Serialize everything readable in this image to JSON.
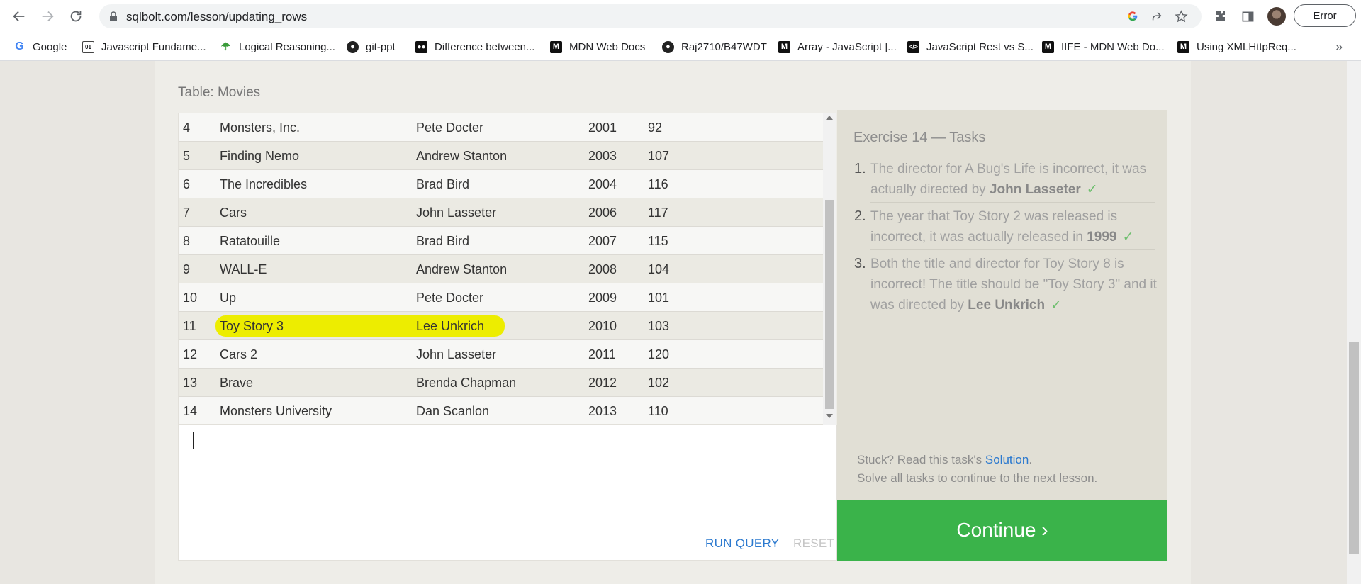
{
  "browser": {
    "url": "sqlbolt.com/lesson/updating_rows",
    "error_label": "Error",
    "bookmarks": [
      {
        "label": "Google",
        "icon": "google-icon"
      },
      {
        "label": "Javascript Fundame...",
        "icon": "code-book-icon"
      },
      {
        "label": "Logical Reasoning...",
        "icon": "umbrella-icon"
      },
      {
        "label": "git-ppt",
        "icon": "github-icon"
      },
      {
        "label": "Difference between...",
        "icon": "medium-icon"
      },
      {
        "label": "MDN Web Docs",
        "icon": "mdn-icon"
      },
      {
        "label": "Raj2710/B47WDT",
        "icon": "github-icon"
      },
      {
        "label": "Array - JavaScript |...",
        "icon": "mdn-icon"
      },
      {
        "label": "JavaScript Rest vs S...",
        "icon": "code-icon"
      },
      {
        "label": "IIFE - MDN Web Do...",
        "icon": "mdn-icon"
      },
      {
        "label": "Using XMLHttpReq...",
        "icon": "mdn-icon"
      }
    ],
    "more_label": "»"
  },
  "table": {
    "title": "Table: Movies",
    "rows": [
      {
        "id": "4",
        "title": "Monsters, Inc.",
        "director": "Pete Docter",
        "year": "2001",
        "length": "92"
      },
      {
        "id": "5",
        "title": "Finding Nemo",
        "director": "Andrew Stanton",
        "year": "2003",
        "length": "107"
      },
      {
        "id": "6",
        "title": "The Incredibles",
        "director": "Brad Bird",
        "year": "2004",
        "length": "116"
      },
      {
        "id": "7",
        "title": "Cars",
        "director": "John Lasseter",
        "year": "2006",
        "length": "117"
      },
      {
        "id": "8",
        "title": "Ratatouille",
        "director": "Brad Bird",
        "year": "2007",
        "length": "115"
      },
      {
        "id": "9",
        "title": "WALL-E",
        "director": "Andrew Stanton",
        "year": "2008",
        "length": "104"
      },
      {
        "id": "10",
        "title": "Up",
        "director": "Pete Docter",
        "year": "2009",
        "length": "101"
      },
      {
        "id": "11",
        "title": "Toy Story 3",
        "director": "Lee Unkrich",
        "year": "2010",
        "length": "103"
      },
      {
        "id": "12",
        "title": "Cars 2",
        "director": "John Lasseter",
        "year": "2011",
        "length": "120"
      },
      {
        "id": "13",
        "title": "Brave",
        "director": "Brenda Chapman",
        "year": "2012",
        "length": "102"
      },
      {
        "id": "14",
        "title": "Monsters University",
        "director": "Dan Scanlon",
        "year": "2013",
        "length": "110"
      }
    ],
    "highlighted_row_id": "11"
  },
  "editor": {
    "query_text": "",
    "run_label": "RUN QUERY",
    "reset_label": "RESET"
  },
  "exercise": {
    "title": "Exercise 14 — Tasks",
    "tasks": [
      {
        "num": "1.",
        "text": "The director for A Bug's Life is incorrect, it was actually directed by ",
        "bold": "John Lasseter",
        "done": true
      },
      {
        "num": "2.",
        "text": "The year that Toy Story 2 was released is incorrect, it was actually released in ",
        "bold": "1999",
        "done": true
      },
      {
        "num": "3.",
        "text": "Both the title and director for Toy Story 8 is incorrect! The title should be \"Toy Story 3\" and it was directed by ",
        "bold": "Lee Unkrich",
        "done": true
      }
    ],
    "check_mark": "✓",
    "stuck_prefix": "Stuck? Read this task's ",
    "solution_link": "Solution",
    "stuck_suffix": ".",
    "solve_note": "Solve all tasks to continue to the next lesson.",
    "continue_label": "Continue ›"
  },
  "colors": {
    "highlight": "#eded00",
    "continue_bg": "#3ab34a",
    "link": "#2b79cf",
    "check": "#6fbf6f"
  }
}
